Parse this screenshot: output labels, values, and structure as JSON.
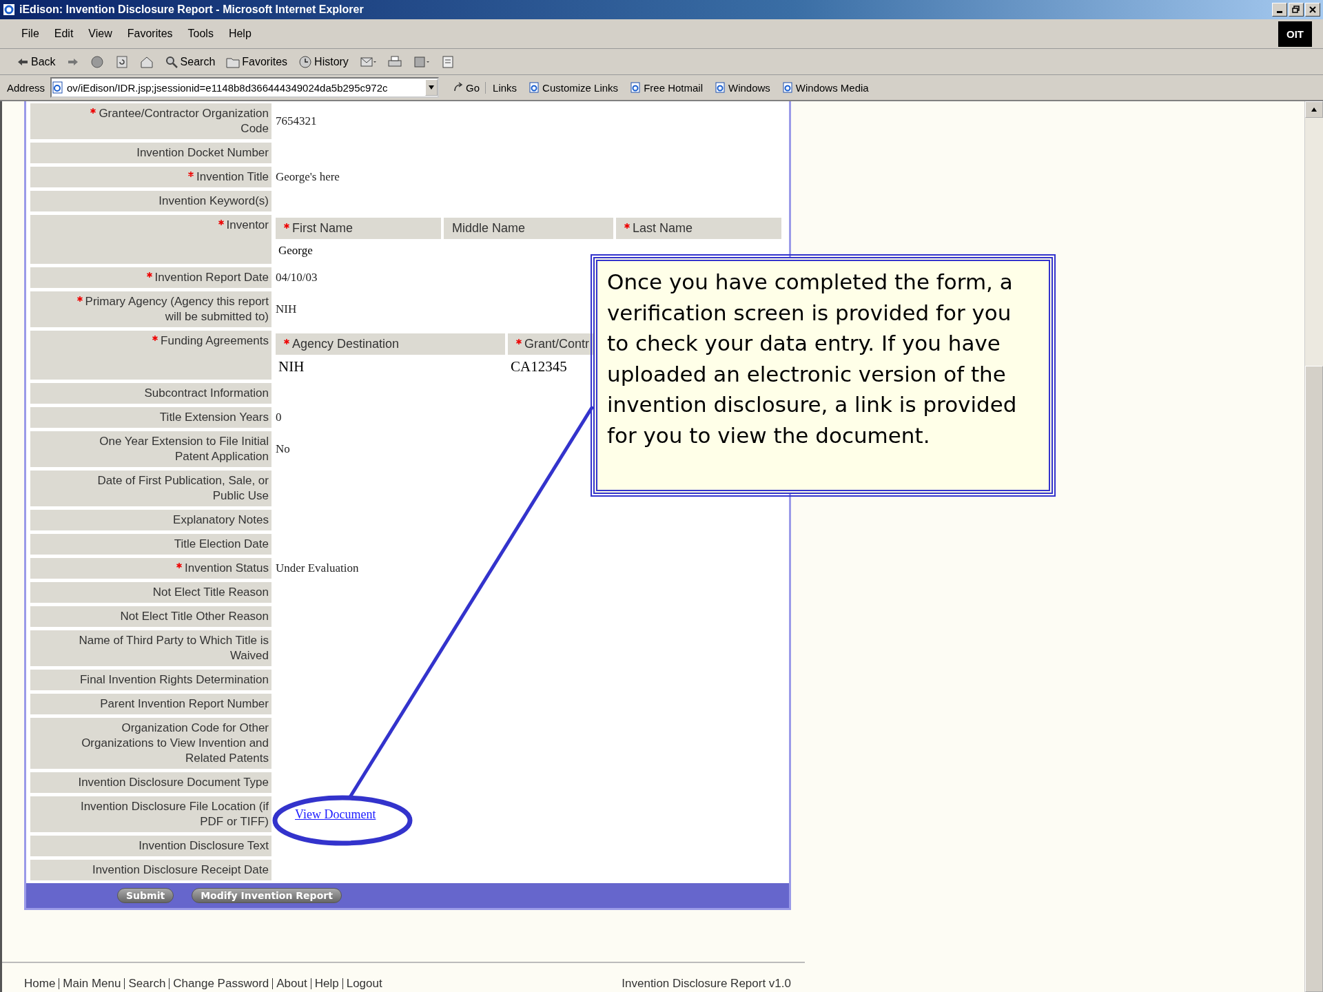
{
  "window": {
    "title": "iEdison: Invention Disclosure Report - Microsoft Internet Explorer",
    "badge": "OIT"
  },
  "menu": [
    "File",
    "Edit",
    "View",
    "Favorites",
    "Tools",
    "Help"
  ],
  "toolbar": [
    {
      "kind": "back",
      "label": "Back"
    },
    {
      "kind": "forward"
    },
    {
      "kind": "stop"
    },
    {
      "kind": "refresh"
    },
    {
      "kind": "home"
    },
    {
      "kind": "search",
      "label": "Search"
    },
    {
      "kind": "favorites",
      "label": "Favorites"
    },
    {
      "kind": "history",
      "label": "History"
    },
    {
      "kind": "mail"
    },
    {
      "kind": "print"
    },
    {
      "kind": "edit"
    },
    {
      "kind": "discuss"
    }
  ],
  "address": {
    "label": "Address",
    "value": "ov/iEdison/IDR.jsp;jsessionid=e1148b8d366444349024da5b295c972c",
    "go": "Go",
    "links_label": "Links",
    "links": [
      "Customize Links",
      "Free Hotmail",
      "Windows",
      "Windows Media"
    ]
  },
  "form": {
    "rows": [
      {
        "kind": "text",
        "label": "Grantee/Contractor Organization Code",
        "required": true,
        "value": "7654321"
      },
      {
        "kind": "text",
        "label": "Invention Docket Number",
        "required": false,
        "value": ""
      },
      {
        "kind": "text",
        "label": "Invention Title",
        "required": true,
        "value": "George's here"
      },
      {
        "kind": "text",
        "label": "Invention Keyword(s)",
        "required": false,
        "value": ""
      },
      {
        "kind": "grid",
        "label": "Inventor",
        "required": true,
        "columns": [
          {
            "label": "First Name",
            "required": true
          },
          {
            "label": "Middle Name",
            "required": false
          },
          {
            "label": "Last Name",
            "required": true
          }
        ],
        "values": [
          "George"
        ]
      },
      {
        "kind": "text",
        "label": "Invention Report Date",
        "required": true,
        "value": "04/10/03"
      },
      {
        "kind": "text",
        "label": "Primary Agency (Agency this report will be submitted to)",
        "required": true,
        "value": "NIH"
      },
      {
        "kind": "grid",
        "label": "Funding Agreements",
        "required": true,
        "columns": [
          {
            "label": "Agency Destination",
            "required": true
          },
          {
            "label": "Grant/Contr",
            "required": true
          }
        ],
        "values": [
          "NIH",
          "CA12345"
        ]
      },
      {
        "kind": "text",
        "label": "Subcontract Information",
        "required": false,
        "value": ""
      },
      {
        "kind": "text",
        "label": "Title Extension Years",
        "required": false,
        "value": "0"
      },
      {
        "kind": "text",
        "label": "One Year Extension to File Initial Patent Application",
        "required": false,
        "value": "No"
      },
      {
        "kind": "text",
        "label": "Date of First Publication, Sale, or Public Use",
        "required": false,
        "value": ""
      },
      {
        "kind": "text",
        "label": "Explanatory Notes",
        "required": false,
        "value": ""
      },
      {
        "kind": "text",
        "label": "Title Election Date",
        "required": false,
        "value": ""
      },
      {
        "kind": "text",
        "label": "Invention Status",
        "required": true,
        "value": "Under Evaluation"
      },
      {
        "kind": "text",
        "label": "Not Elect Title Reason",
        "required": false,
        "value": ""
      },
      {
        "kind": "text",
        "label": "Not Elect Title Other Reason",
        "required": false,
        "value": ""
      },
      {
        "kind": "text",
        "label": "Name of Third Party to Which Title is Waived",
        "required": false,
        "value": ""
      },
      {
        "kind": "text",
        "label": "Final Invention Rights Determination",
        "required": false,
        "value": ""
      },
      {
        "kind": "text",
        "label": "Parent Invention Report Number",
        "required": false,
        "value": ""
      },
      {
        "kind": "text",
        "label": "Organization Code for Other Organizations to View Invention and Related Patents",
        "required": false,
        "value": ""
      },
      {
        "kind": "text",
        "label": "Invention Disclosure Document Type",
        "required": false,
        "value": ""
      },
      {
        "kind": "link",
        "label": "Invention Disclosure File Location (if PDF or TIFF)",
        "required": false,
        "value": "View Document"
      },
      {
        "kind": "text",
        "label": "Invention Disclosure Text",
        "required": false,
        "value": ""
      },
      {
        "kind": "text",
        "label": "Invention Disclosure Receipt Date",
        "required": false,
        "value": ""
      }
    ],
    "buttons": [
      "Submit",
      "Modify Invention Report"
    ]
  },
  "footer": {
    "links": [
      "Home",
      "Main Menu",
      "Search",
      "Change Password",
      "About",
      "Help",
      "Logout"
    ],
    "version": "Invention Disclosure Report v1.0"
  },
  "callout": {
    "text": "Once you have completed the form, a verification screen is provided for you to check your data entry.  If you have uploaded an electronic version of the invention disclosure, a link is provided for you to view the document."
  }
}
